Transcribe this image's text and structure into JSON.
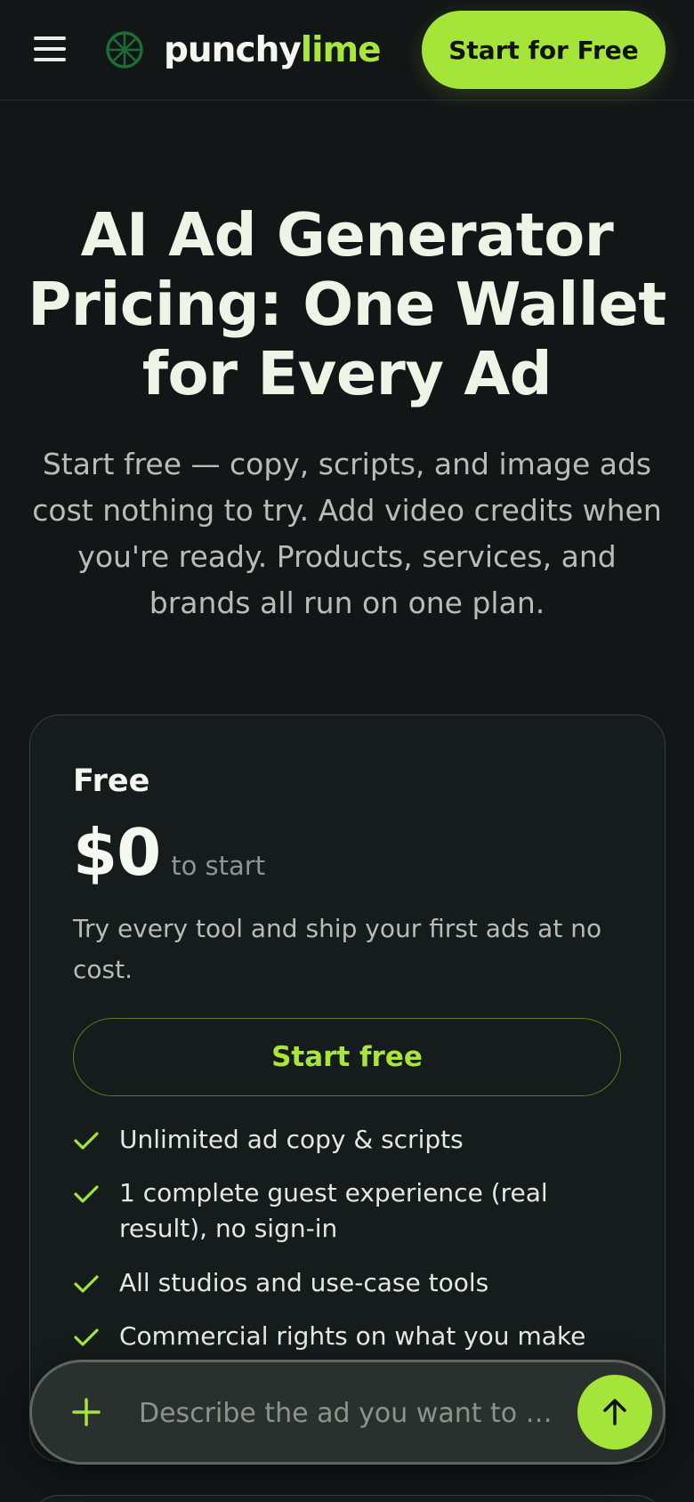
{
  "header": {
    "logo_word_1": "punchy",
    "logo_word_2": "lime",
    "cta_label": "Start for Free"
  },
  "hero": {
    "title": "AI Ad Generator Pricing: One Wallet for Every Ad",
    "subtitle": "Start free — copy, scripts, and image ads cost nothing to try. Add video credits when you're ready. Products, services, and brands all run on one plan."
  },
  "plan": {
    "name": "Free",
    "price": "$0",
    "price_suffix": "to start",
    "description": "Try every tool and ship your first ads at no cost.",
    "button_label": "Start free",
    "features": [
      "Unlimited ad copy & scripts",
      "1 complete guest experience (real result), no sign-in",
      "All studios and use-case tools",
      "Commercial rights on what you make"
    ]
  },
  "prompt": {
    "placeholder": "Describe the ad you want to …"
  },
  "colors": {
    "accent": "#a5e53a",
    "background": "#121617",
    "card": "#161b1c"
  },
  "icons": {
    "menu": "hamburger-icon",
    "logo": "lime-slice-icon",
    "feature": "check-icon",
    "attach": "plus-icon",
    "send": "arrow-up-icon"
  }
}
